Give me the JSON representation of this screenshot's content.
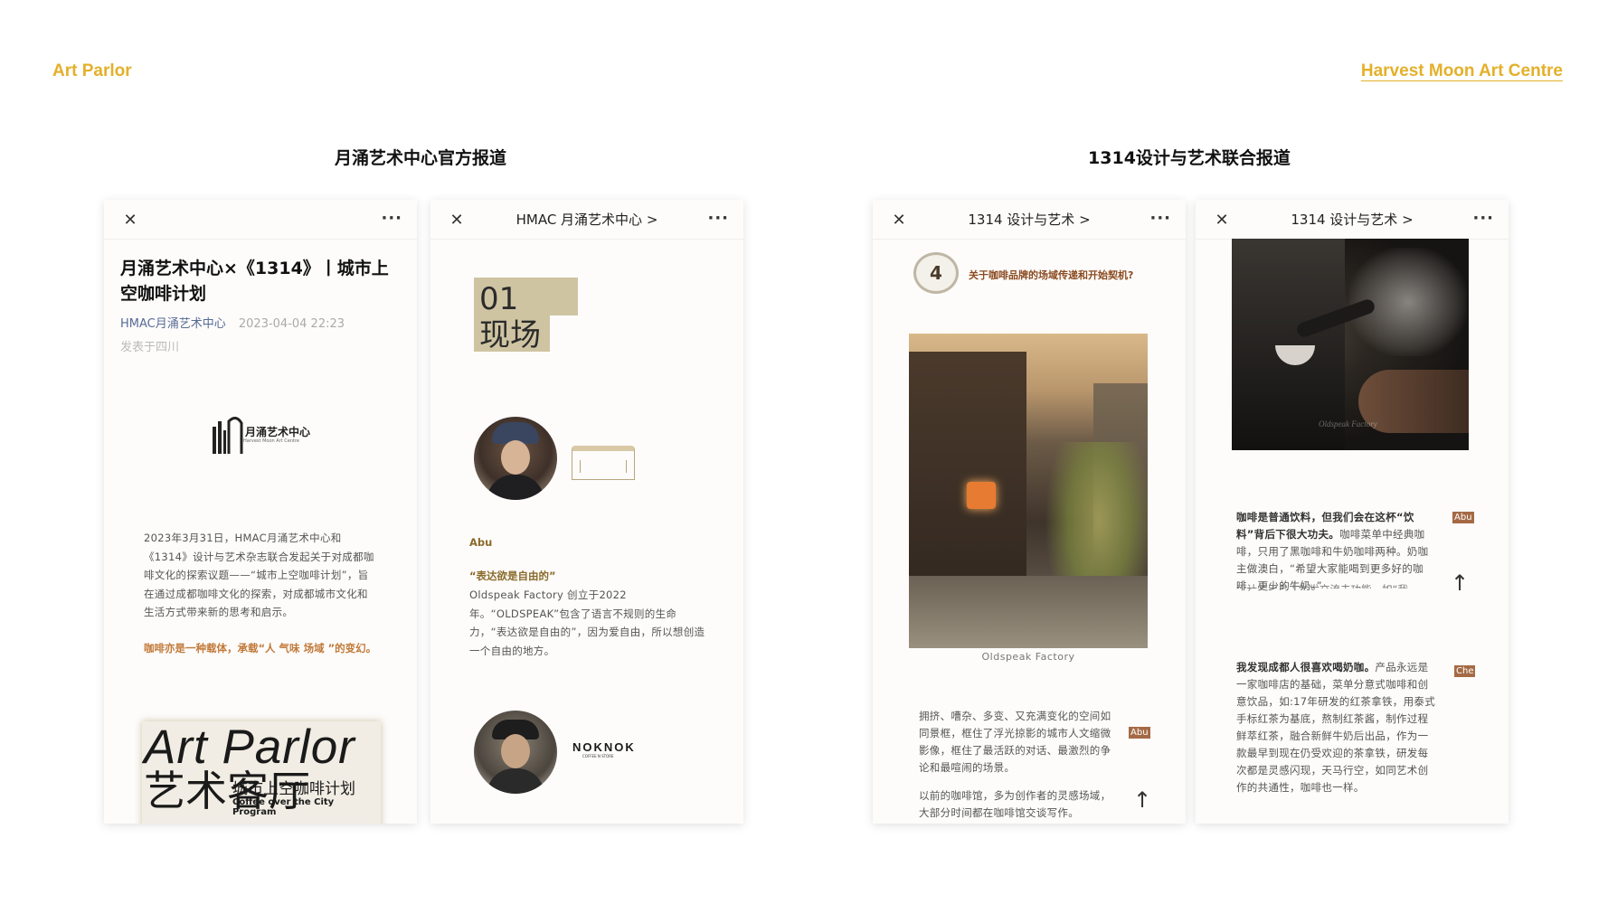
{
  "header": {
    "left_label": "Art Parlor",
    "right_link": "Harvest Moon Art Centre"
  },
  "sections": {
    "left_title": "月涌艺术中心官方报道",
    "right_title": "1314设计与艺术联合报道"
  },
  "phone1": {
    "article_title": "月涌艺术中心×《1314》丨城市上空咖啡计划",
    "account": "HMAC月涌艺术中心",
    "date": "2023-04-04 22:23",
    "location": "发表于四川",
    "logo_text": "月涌艺术中心",
    "logo_sub": "Harvest Moon Art Centre",
    "body": "2023年3月31日，HMAC月涌艺术中心和《1314》设计与艺术杂志联合发起关于对成都咖啡文化的探索议题——“城市上空咖啡计划”，旨在通过成都咖啡文化的探索，对成都城市文化和生活方式带来新的思考和启示。",
    "highlight": "咖啡亦是一种载体，承载“人 气味 场域 ”的变幻。",
    "poster_title": "Art Parlor",
    "poster_cn_big": "艺术客厅",
    "poster_cn": "城市上空咖啡计划",
    "poster_en": "Coffee over the City Program"
  },
  "phone2": {
    "bar_title": "HMAC 月涌艺术中心 >",
    "section_num": "01",
    "section_name": "现场",
    "speaker": "Abu",
    "quote_title": "“表达欲是自由的”",
    "quote_body": "Oldspeak Factory 创立于2022年。“OLDSPEAK”包含了语言不规则的生命力，“表达欲是自由的”，因为爱自由，所以想创造一个自由的地方。",
    "shop_name": "NOKNOK",
    "shop_sub": "COFFEE N STORE"
  },
  "phone3": {
    "bar_title": "1314 设计与艺术 >",
    "cup_number": "4",
    "question": "关于咖啡品牌的场域传递和开始契机?",
    "photo_caption": "Oldspeak Factory",
    "body": "拥挤、嘈杂、多变、又充满变化的空间如同景框，框住了浮光掠影的城市人文缩微影像，框住了最活跃的对话、最激烈的争论和最喧闹的场景。",
    "body2": "以前的咖啡馆，多为创作者的灵感场域，大部分时间都在咖啡馆交谈写作。",
    "tag": "Abu"
  },
  "phone4": {
    "bar_title": "1314 设计与艺术 >",
    "watermark": "Oldspeak Factory",
    "body_bold": "咖啡是普通饮料，但我们会在这杯“饮料”背后下很大功夫。",
    "body": "咖啡菜单中经典咖啡，只用了黑咖啡和牛奶咖啡两种。奶咖主做澳白，“希望大家能喝到更多好的咖啡，更少的牛奶。”",
    "body_cut": "设计师用具去触发交流去功能，如“我",
    "tag1": "Abu",
    "body2_bold": "我发现成都人很喜欢喝奶咖。",
    "body2": "产品永远是一家咖啡店的基础，菜单分意式咖啡和创意饮品，如:17年研发的红茶拿铁，用泰式手标红茶为基底，熬制红茶酱，制作过程鲜萃红茶，融合新鲜牛奶后出品，作为一款最早到现在仍受欢迎的茶拿铁，研发每次都是灵感闪现，天马行空，如同艺术创作的共通性，咖啡也一样。",
    "tag2": "Che"
  },
  "icons": {
    "close": "close-icon",
    "more": "more-icon",
    "cursor": "cursor-icon"
  },
  "colors": {
    "accent": "#e4b02a",
    "link_blue": "#576b95",
    "highlight_orange": "#c27a3a",
    "section_box": "#cfc4a2",
    "tag_brown": "#a56a45"
  }
}
